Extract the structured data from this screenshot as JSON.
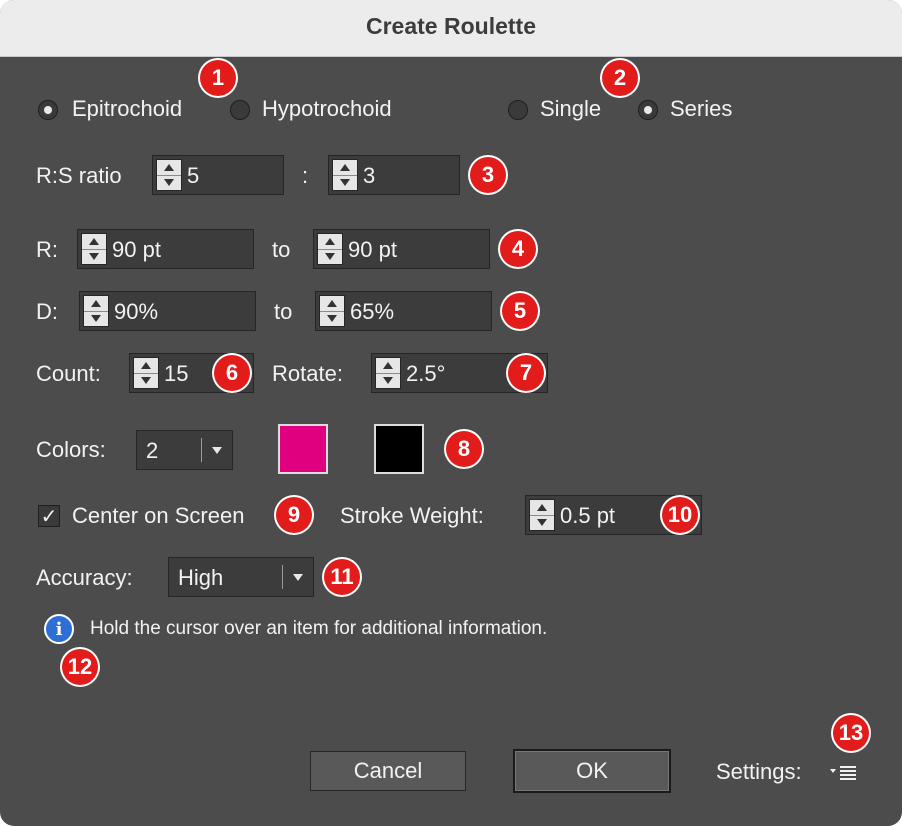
{
  "window": {
    "title": "Create Roulette"
  },
  "mode": {
    "epitrochoid": "Epitrochoid",
    "hypotrochoid": "Hypotrochoid",
    "selected": "Epitrochoid"
  },
  "output": {
    "single": "Single",
    "series": "Series",
    "selected": "Series"
  },
  "ratio": {
    "label": "R:S ratio",
    "left": "5",
    "separator": ":",
    "right": "3"
  },
  "r": {
    "label": "R:",
    "from": "90 pt",
    "to_label": "to",
    "to": "90 pt"
  },
  "d": {
    "label": "D:",
    "from": "90%",
    "to_label": "to",
    "to": "65%"
  },
  "count": {
    "label": "Count:",
    "value": "15"
  },
  "rotate": {
    "label": "Rotate:",
    "value": "2.5°"
  },
  "colors": {
    "label": "Colors:",
    "value": "2",
    "swatches": [
      "#e0007f",
      "#000000"
    ]
  },
  "center": {
    "label": "Center on Screen",
    "checked": true,
    "mark": "✓"
  },
  "stroke": {
    "label": "Stroke Weight:",
    "value": "0.5 pt"
  },
  "accuracy": {
    "label": "Accuracy:",
    "value": "High"
  },
  "info": {
    "icon": "i",
    "text": "Hold the cursor over an item for additional information."
  },
  "buttons": {
    "cancel": "Cancel",
    "ok": "OK"
  },
  "settings": {
    "label": "Settings:"
  },
  "callouts": [
    "1",
    "2",
    "3",
    "4",
    "5",
    "6",
    "7",
    "8",
    "9",
    "10",
    "11",
    "12",
    "13"
  ]
}
